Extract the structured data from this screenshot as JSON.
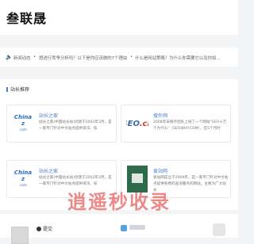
{
  "site": {
    "logo_text": "叁联晟"
  },
  "news": {
    "label": "新闻动态",
    "items": [
      "想进行竞争分析吗？以下是你应该做的7个理由",
      "什么是网站策略？为什么你需要它以及你如..."
    ]
  },
  "recommend": {
    "title": "站长推荐",
    "cards": [
      {
        "title": "站长之家",
        "desc": "站长之家(中国站长站)创建于2002年3月，是一家专门针对中文站点提供资讯、技",
        "thumb_main": "China z",
        "thumb_sub": ".com"
      },
      {
        "title": "搜外网",
        "desc": "2008年末搜外团队上线了一个网站\"SEO十万个为什么\"（SEOWHY.COM），在5个月时",
        "thumb_main": "SEO",
        "thumb_accent": ".cn"
      },
      {
        "title": "站长之家",
        "desc": "站长之家(中国站长站)创建于2002年3月，是一家专门针对中文站点提供资讯、技",
        "thumb_main": "China z",
        "thumb_sub": ".com"
      },
      {
        "title": "爱站网",
        "desc": "爱站网成立于2009年，是一家专门针对中文站点提供免费的查询服务的网站，主要为广大站长",
        "thumb_main": ""
      }
    ]
  },
  "footer": {
    "submit_label": "提交"
  },
  "watermark": "逍遥秒收录",
  "colors": {
    "accent": "#4a7cc9",
    "background": "#f3f4f5",
    "watermark": "#dc2828"
  }
}
